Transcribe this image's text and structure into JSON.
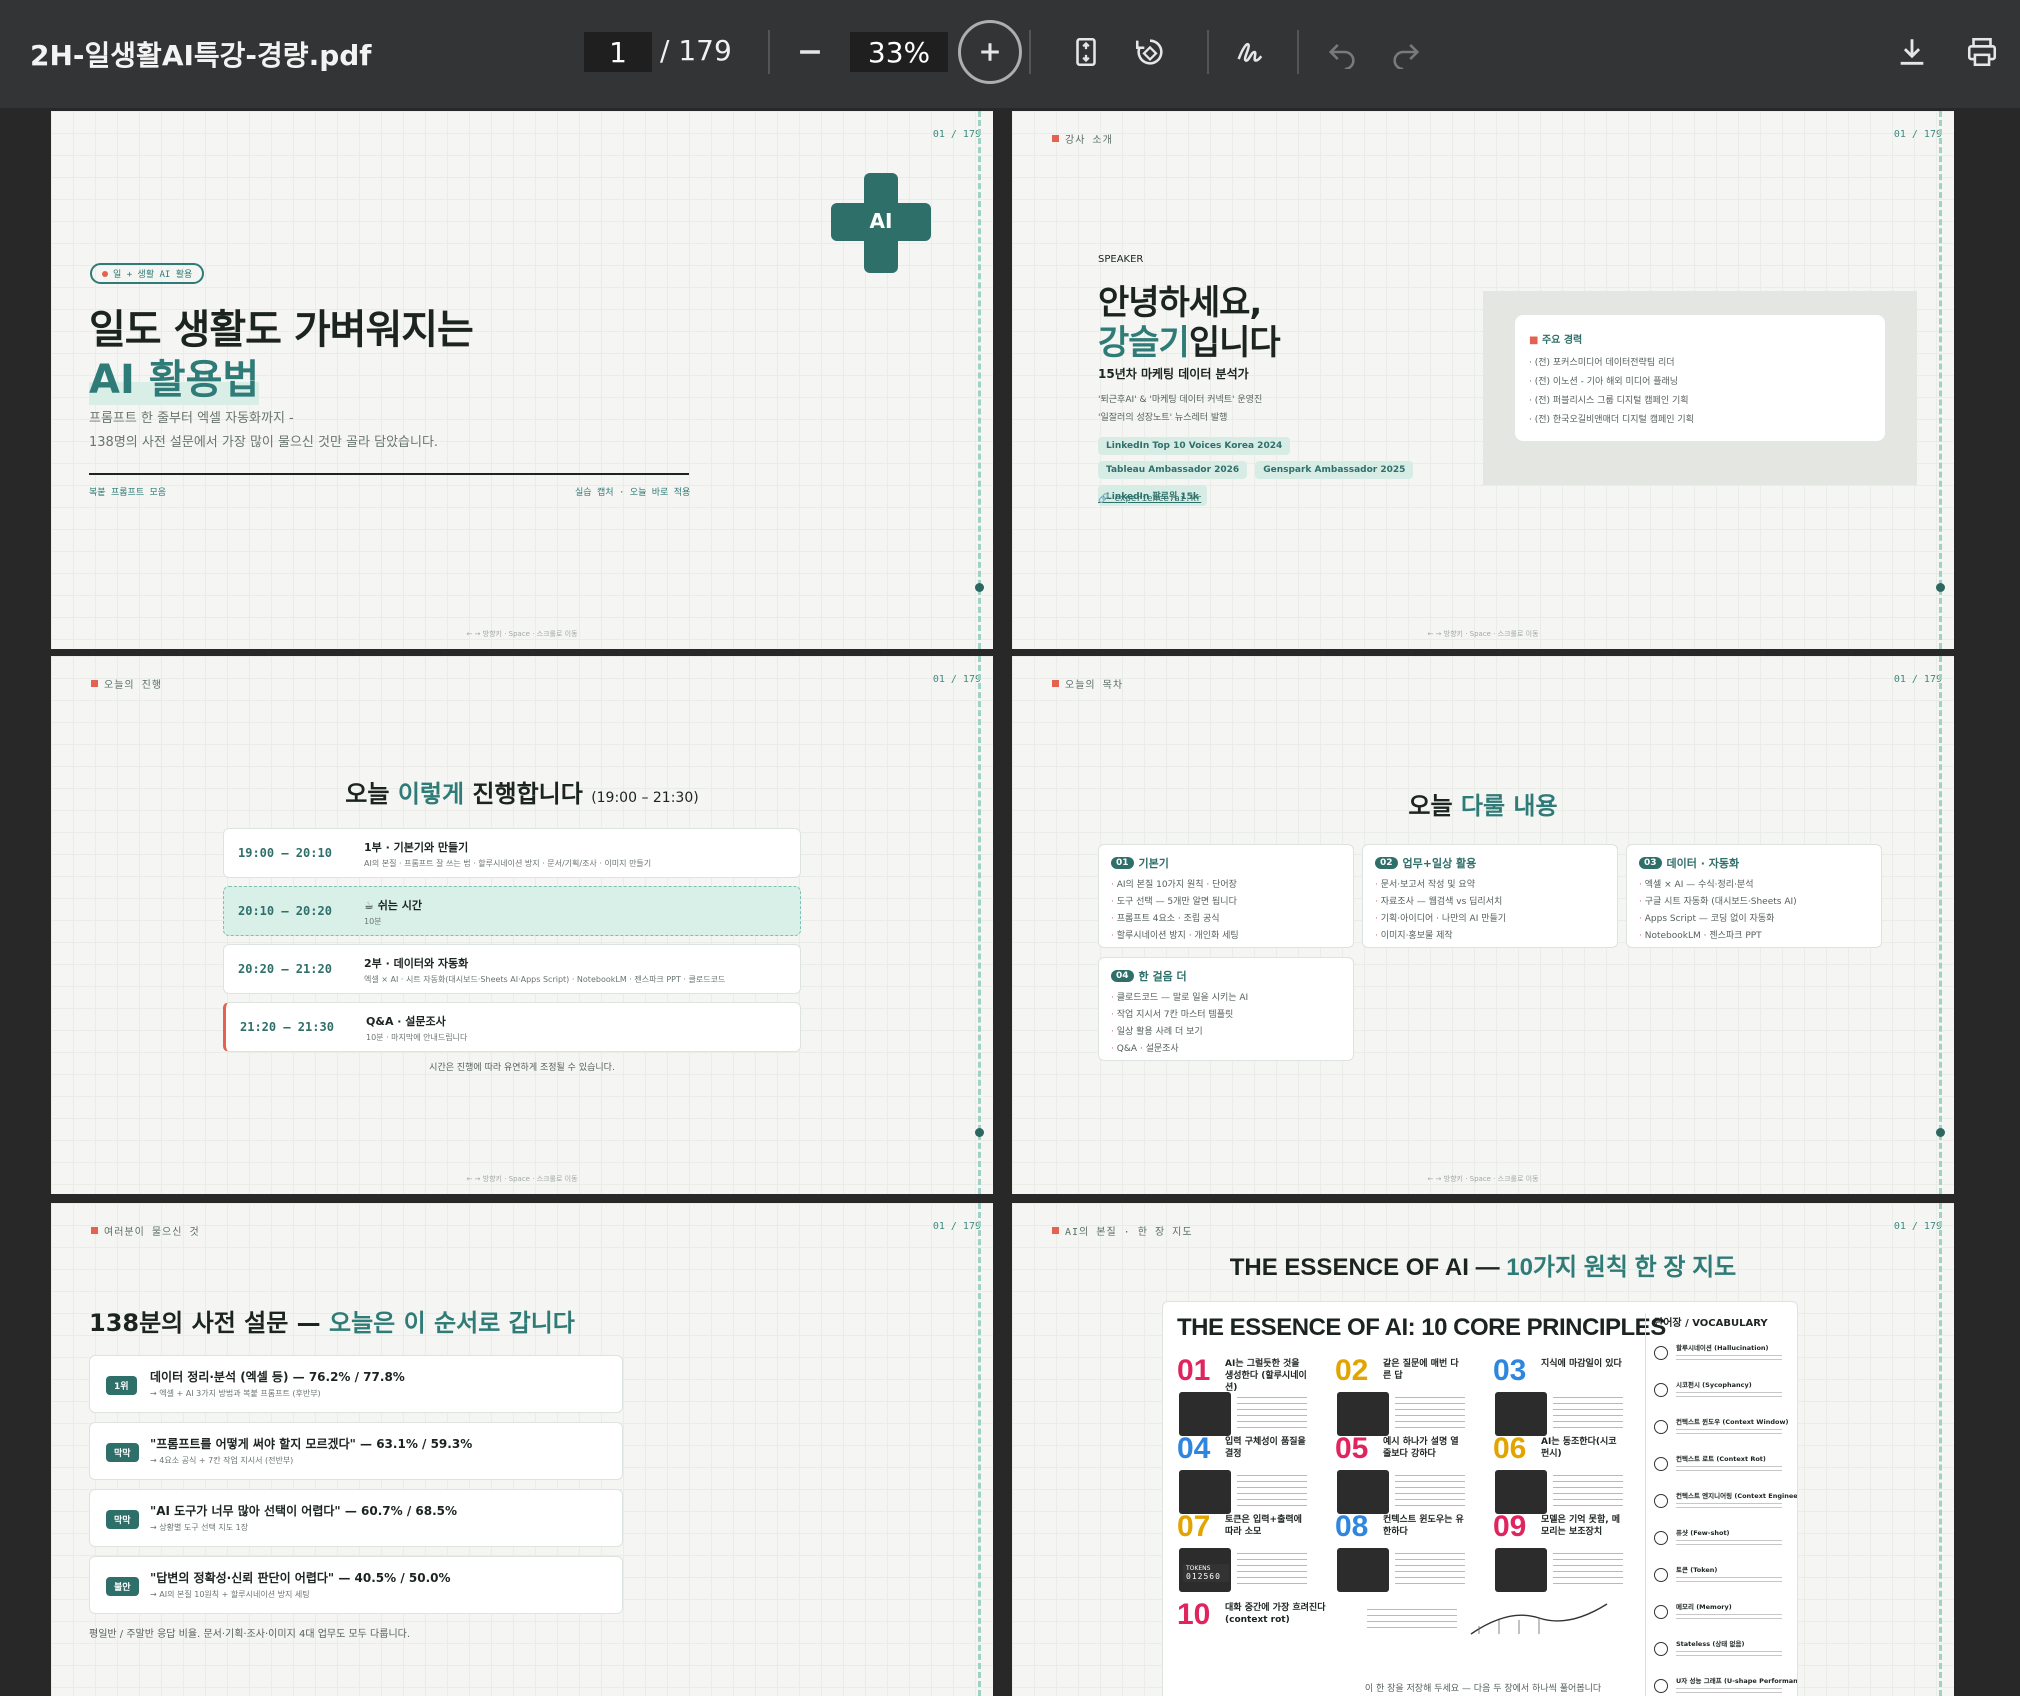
{
  "toolbar": {
    "file_name": "2H-일생활AI특강-경량.pdf",
    "page_current": "1",
    "page_total": "/ 179",
    "zoom": "33%"
  },
  "common": {
    "page_counter": "01 / 179",
    "footer": "← → 방향키 · Space · 스크롤로 이동"
  },
  "p1": {
    "badge": "일 + 생활 AI 활용",
    "cross_text": "AI",
    "title_line1": "일도 생활도 가벼워지는",
    "title_line2": "AI 활용법",
    "sub1": "프롬프트 한 줄부터 엑셀 자동화까지 -",
    "sub2": "138명의 사전 설문에서 가장 많이 물으신 것만 골라 담았습니다.",
    "foot_left": "복붙 프롬프트 모음",
    "foot_right": "실습 캡처 · 오늘 바로 적용"
  },
  "p2": {
    "label": "강사 소개",
    "kicker": "SPEAKER",
    "hello": "안녕하세요,",
    "name": "강슬기",
    "name_suffix": "입니다",
    "role": "15년차 마케팅 데이터 분석가",
    "desc1": "'퇴근후AI' & '마케팅 데이터 커넥트' 운영진",
    "desc2": "'일잘러의 성장노트' 뉴스레터 발행",
    "tags": [
      "LinkedIn Top 10 Voices Korea 2024",
      "Tableau Ambassador 2026",
      "Genspark Ambassador 2025",
      "LinkedIn 팔로워 15k"
    ],
    "link": "experience.ai.kr",
    "career_title": "주요 경력",
    "career": [
      "(전) 포커스미디어 데이터전략팀 리더",
      "(전) 이노션 - 기아 해외 미디어 플래닝",
      "(전) 퍼블리시스 그룹 디지털 캠페인 기획",
      "(전) 한국오길비앤매더 디지털 캠페인 기획"
    ]
  },
  "p3": {
    "label": "오늘의 진행",
    "title_pre": "오늘 ",
    "title_accent": "이렇게",
    "title_post": " 진행합니다",
    "title_time": "(19:00 – 21:30)",
    "rows": [
      {
        "time": "19:00 – 20:10",
        "title": "1부 · 기본기와 만들기",
        "desc": "AI의 본질 · 프롬프트 잘 쓰는 법 · 할루시네이션 방지 · 문서/기획/조사 · 이미지 만들기"
      },
      {
        "time": "20:10 – 20:20",
        "title": "☕ 쉬는 시간",
        "desc": "10분"
      },
      {
        "time": "20:20 – 21:20",
        "title": "2부 · 데이터와 자동화",
        "desc": "엑셀 × AI · 시트 자동화(대시보드·Sheets AI·Apps Script) · NotebookLM · 젠스파크 PPT · 클로드코드"
      },
      {
        "time": "21:20 – 21:30",
        "title": "Q&A · 설문조사",
        "desc": "10분 · 마지막에 안내드립니다"
      }
    ],
    "note": "시간은 진행에 따라 유연하게 조정될 수 있습니다."
  },
  "p4": {
    "label": "오늘의 목차",
    "title_pre": "오늘 ",
    "title_accent": "다룰 내용",
    "topics": [
      {
        "num": "01",
        "title": "기본기",
        "items": [
          "AI의 본질 10가지 원칙 · 단어장",
          "도구 선택 — 5개만 알면 됩니다",
          "프롬프트 4요소 · 조립 공식",
          "할루시네이션 방지 · 개인화 세팅"
        ]
      },
      {
        "num": "02",
        "title": "업무+일상 활용",
        "items": [
          "문서·보고서 작성 및 요약",
          "자료조사 — 웹검색 vs 딥리서치",
          "기획·아이디어 · 나만의 AI 만들기",
          "이미지·홍보물 제작"
        ]
      },
      {
        "num": "03",
        "title": "데이터 · 자동화",
        "items": [
          "엑셀 × AI — 수식·정리·분석",
          "구글 시트 자동화 (대시보드·Sheets AI)",
          "Apps Script — 코딩 없이 자동화",
          "NotebookLM · 젠스파크 PPT"
        ]
      },
      {
        "num": "04",
        "title": "한 걸음 더",
        "items": [
          "클로드코드 — 말로 일을 시키는 AI",
          "작업 지시서 7칸 마스터 템플릿",
          "일상 활용 사례 더 보기",
          "Q&A · 설문조사"
        ]
      }
    ]
  },
  "p5": {
    "label": "여러분이 물으신 것",
    "title_pre": "138분의 사전 설문 — ",
    "title_accent": "오늘은 이 순서로 갑니다",
    "items": [
      {
        "badge": "1위",
        "q": "데이터 정리·분석 (엑셀 등) — 76.2% / 77.8%",
        "a": "→ 엑셀 + AI 3가지 방법과 복붙 프롬프트 (후반부)"
      },
      {
        "badge": "막막",
        "q": "\"프롬프트를 어떻게 써야 할지 모르겠다\" — 63.1% / 59.3%",
        "a": "→ 4요소 공식 + 7칸 작업 지시서 (전반부)"
      },
      {
        "badge": "막막",
        "q": "\"AI 도구가 너무 많아 선택이 어렵다\" — 60.7% / 68.5%",
        "a": "→ 상황별 도구 선택 지도 1장"
      },
      {
        "badge": "불안",
        "q": "\"답변의 정확성·신뢰 판단이 어렵다\" — 40.5% / 50.0%",
        "a": "→ AI의 본질 10원칙 + 할루시네이션 방지 세팅"
      }
    ],
    "note": "평일반 / 주말반 응답 비율. 문서·기획·조사·이미지 4대 업무도 모두 다룹니다."
  },
  "p6": {
    "label": "AI의 본질 · 한 장 지도",
    "title_pre": "THE ESSENCE OF AI — ",
    "title_accent": "10가지 원칙 한 장 지도",
    "poster_title": "THE ESSENCE OF AI: 10 CORE PRINCIPLES",
    "principles": [
      {
        "n": "01",
        "h": "AI는 그럴듯한 것을 생성한다 (할루시네이션)",
        "color": "#e0245e"
      },
      {
        "n": "02",
        "h": "같은 질문에 매번 다른 답",
        "color": "#e2a400"
      },
      {
        "n": "03",
        "h": "지식에 마감일이 있다",
        "color": "#2e86de"
      },
      {
        "n": "04",
        "h": "입력 구체성이 품질을 결정",
        "color": "#2e86de"
      },
      {
        "n": "05",
        "h": "예시 하나가 설명 열 줄보다 강하다",
        "color": "#e0245e"
      },
      {
        "n": "06",
        "h": "AI는 동조한다(시코펀시)",
        "color": "#e2a400"
      },
      {
        "n": "07",
        "h": "토큰은 입력+출력에 따라 소모",
        "color": "#e2a400"
      },
      {
        "n": "08",
        "h": "컨텍스트 윈도우는 유한하다",
        "color": "#2e86de"
      },
      {
        "n": "09",
        "h": "모델은 기억 못함, 메모리는 보조장치",
        "color": "#e0245e"
      },
      {
        "n": "10",
        "h": "대화 중간에 가장 흐려진다 (context rot)",
        "color": "#e0245e"
      }
    ],
    "tokens_label": "TOKENS",
    "tokens_value": "012560",
    "vocab_title": "단어장 / VOCABULARY",
    "vocab": [
      "할루시네이션 (Hallucination)",
      "시코펀시 (Sycophancy)",
      "컨텍스트 윈도우 (Context Window)",
      "컨텍스트 로트 (Context Rot)",
      "컨텍스트 엔지니어링 (Context Engineering)",
      "퓨샷 (Few-shot)",
      "토큰 (Token)",
      "메모리 (Memory)",
      "Stateless (상태 없음)",
      "U자 성능 그래프 (U-shape Performance)"
    ],
    "bottom_note": "이 한 장을 저장해 두세요 — 다음 두 장에서 하나씩 풀어봅니다"
  }
}
